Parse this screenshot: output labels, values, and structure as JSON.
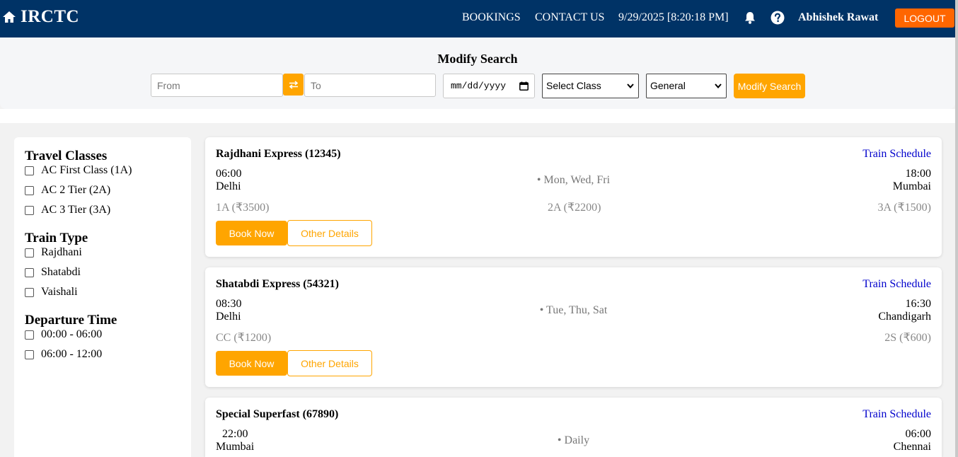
{
  "header": {
    "brand": "IRCTC",
    "nav": [
      "BOOKINGS",
      "CONTACT US"
    ],
    "datetime": "9/29/2025 [8:20:18 PM]",
    "username": "Abhishek Rawat",
    "logout": "LOGOUT",
    "icons": [
      "home-icon",
      "bell-icon",
      "help-icon"
    ],
    "colors": {
      "bar": "#003366",
      "logout": "#ff6600"
    }
  },
  "search": {
    "title": "Modify Search",
    "from_placeholder": "From",
    "to_placeholder": "To",
    "date_placeholder": "mm/dd/yyyy",
    "class_value": "Select Class",
    "quota_value": "General",
    "button": "Modify Search",
    "accent": "#ffa500"
  },
  "filters": {
    "travel_classes": {
      "heading": "Travel Classes",
      "items": [
        "AC First Class (1A)",
        "AC 2 Tier (2A)",
        "AC 3 Tier (3A)"
      ]
    },
    "train_type": {
      "heading": "Train Type",
      "items": [
        "Rajdhani",
        "Shatabdi",
        "Vaishali"
      ]
    },
    "departure_time": {
      "heading": "Departure Time",
      "items": [
        "00:00 - 06:00",
        "06:00 - 12:00"
      ]
    }
  },
  "trains": [
    {
      "name": "Rajdhani Express (12345)",
      "schedule_link": "Train Schedule",
      "dep_time": "06:00",
      "dep_station": "Delhi",
      "days": "• Mon, Wed, Fri",
      "arr_time": "18:00",
      "arr_station": "Mumbai",
      "fares": [
        "1A (₹3500)",
        "2A (₹2200)",
        "3A (₹1500)"
      ],
      "book": "Book Now",
      "details": "Other Details"
    },
    {
      "name": "Shatabdi Express (54321)",
      "schedule_link": "Train Schedule",
      "dep_time": "08:30",
      "dep_station": "Delhi",
      "days": "• Tue, Thu, Sat",
      "arr_time": "16:30",
      "arr_station": "Chandigarh",
      "fares": [
        "CC (₹1200)",
        "2S (₹600)"
      ],
      "book": "Book Now",
      "details": "Other Details"
    },
    {
      "name": "Special Superfast (67890)",
      "schedule_link": "Train Schedule",
      "dep_time": "22:00",
      "dep_station": "Mumbai",
      "days": "• Daily",
      "arr_time": "06:00",
      "arr_station": "Chennai"
    }
  ]
}
